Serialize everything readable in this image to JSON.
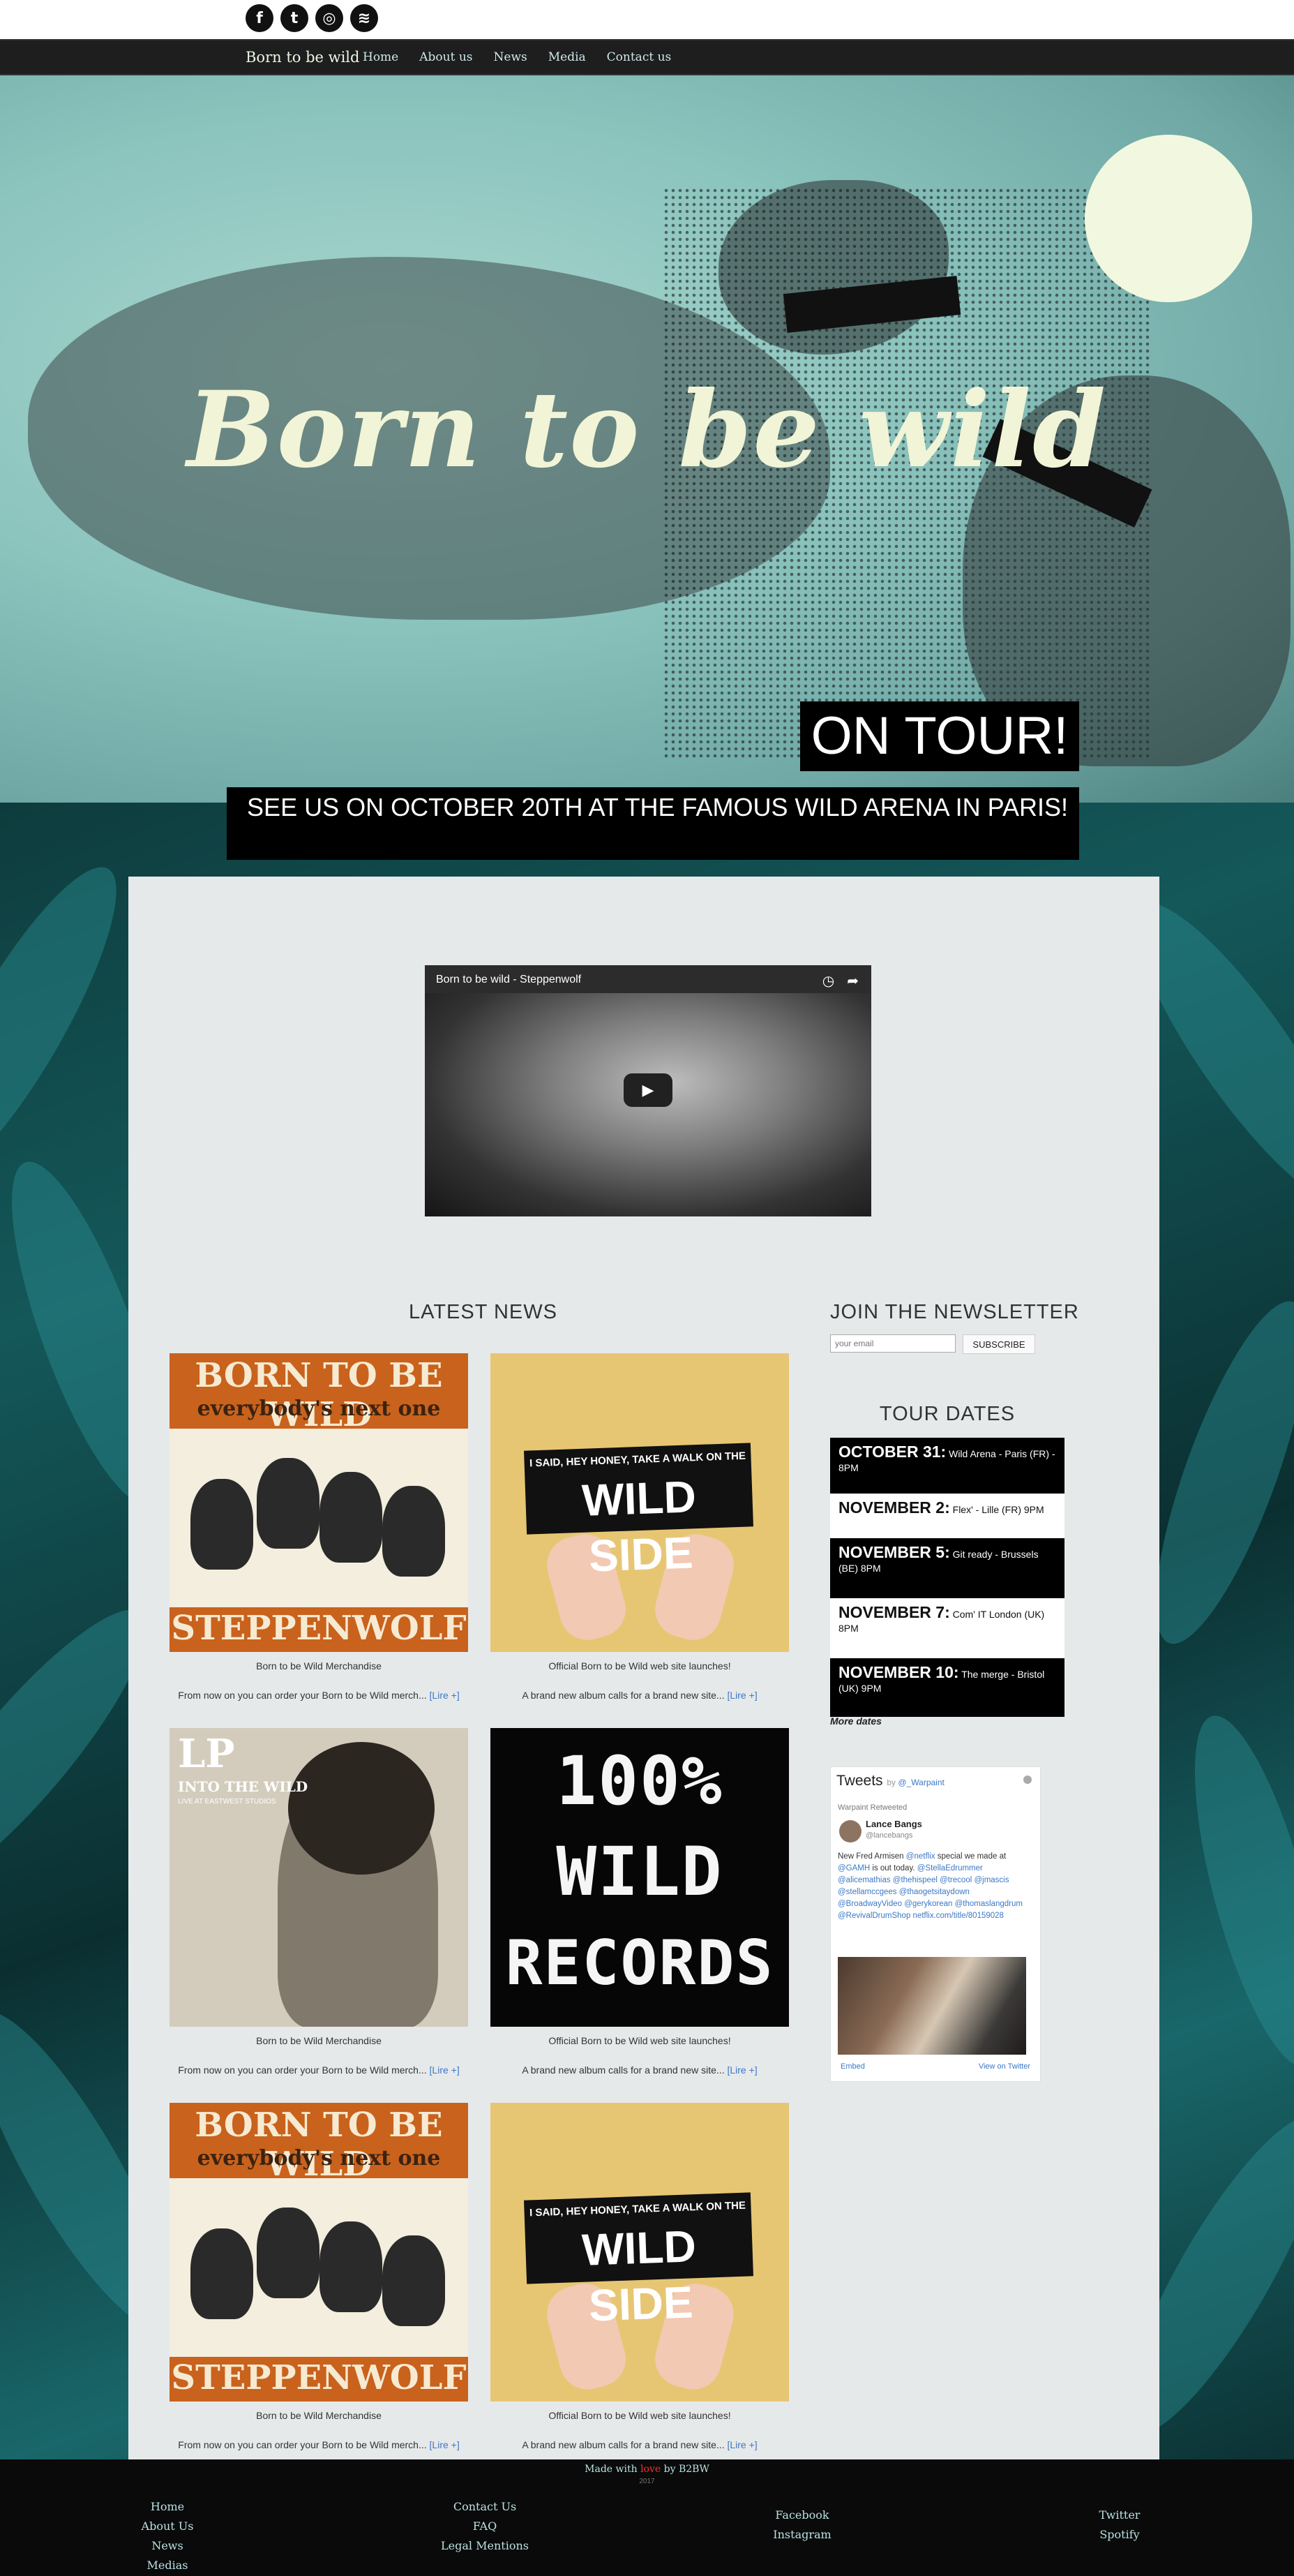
{
  "social": {
    "icons": [
      "facebook-icon",
      "twitter-icon",
      "instagram-icon",
      "spotify-icon"
    ],
    "glyphs": [
      "f",
      "t",
      "◎",
      "≋"
    ]
  },
  "nav": {
    "brand": "Born to be wild",
    "links": [
      "Home",
      "About us",
      "News",
      "Media",
      "Contact us"
    ]
  },
  "hero": {
    "title": "Born to be wild",
    "tour_label": "ON TOUR!",
    "tour_sub": "SEE US ON OCTOBER 20TH AT THE FAMOUS WILD ARENA IN PARIS!"
  },
  "video": {
    "title": "Born to be wild - Steppenwolf",
    "icons": [
      "watch-later-icon",
      "share-icon",
      "play-icon"
    ]
  },
  "news": {
    "heading": "LATEST NEWS",
    "more_label": "[Lire +]",
    "items": [
      {
        "art": "steppenwolf",
        "caption": "Born to be Wild Merchandise",
        "desc": "From now on you can order your Born to be Wild merch..."
      },
      {
        "art": "wildside",
        "caption": "Official Born to be Wild web site launches!",
        "desc": "A brand new album calls for a brand new site..."
      },
      {
        "art": "lp",
        "caption": "Born to be Wild Merchandise",
        "desc": "From now on you can order your Born to be Wild merch..."
      },
      {
        "art": "records",
        "caption": "Official Born to be Wild web site launches!",
        "desc": "A brand new album calls for a brand new site..."
      },
      {
        "art": "steppenwolf",
        "caption": "Born to be Wild Merchandise",
        "desc": "From now on you can order your Born to be Wild merch..."
      },
      {
        "art": "wildside",
        "caption": "Official Born to be Wild web site launches!",
        "desc": "A brand new album calls for a brand new site..."
      }
    ],
    "art_text": {
      "steppenwolf": {
        "line1": "BORN TO BE WILD",
        "line2": "everybody's next one",
        "line3": "STEPPENWOLF"
      },
      "wildside": {
        "line1": "I SAID, HEY HONEY, TAKE A WALK ON THE",
        "line2": "WILD SIDE"
      },
      "lp": {
        "line1": "LP",
        "line2": "INTO THE WILD",
        "line3": "LIVE AT EASTWEST STUDIOS"
      },
      "records": {
        "line1": "100%",
        "line2": "WILD",
        "line3": "RECORDS"
      }
    }
  },
  "newsletter": {
    "heading": "JOIN THE NEWSLETTER",
    "placeholder": "your email",
    "button": "SUBSCRIBE"
  },
  "tour": {
    "heading": "TOUR DATES",
    "dates": [
      {
        "date": "OCTOBER 31:",
        "info": "Wild Arena - Paris (FR) - 8PM",
        "style": "dark"
      },
      {
        "date": "NOVEMBER 2:",
        "info": "Flex' - Lille (FR) 9PM",
        "style": "light"
      },
      {
        "date": "NOVEMBER 5:",
        "info": "Git ready - Brussels (BE) 8PM",
        "style": "dark"
      },
      {
        "date": "NOVEMBER 7:",
        "info": "Com' IT London (UK) 8PM",
        "style": "light"
      },
      {
        "date": "NOVEMBER 10:",
        "info": "The merge - Bristol (UK) 9PM",
        "style": "dark"
      }
    ],
    "more": "More dates"
  },
  "twitter": {
    "title": "Tweets",
    "by": "by",
    "handle": "@_Warpaint",
    "retweet": "Warpaint Retweeted",
    "author": "Lance Bangs",
    "author_handle": "@lancebangs",
    "body_text": "New Fred Armisen",
    "body_text2": "special we made at",
    "body_text3": "is out today.",
    "links": [
      "@netflix",
      "@GAMH",
      "@StellaEdrummer",
      "@alicemathias @thehispeel @trecool @jmascis @stellamccgees @thaogetsitaydown @BroadwayVideo @gerykorean @thomaslangdrum @RevivalDrumShop netflix.com/title/80159028"
    ],
    "embed": "Embed",
    "view": "View on Twitter"
  },
  "footer": {
    "made_prefix": "Made with",
    "love": "love",
    "made_suffix": "by B2BW",
    "year": "2017",
    "col1": [
      "Home",
      "About Us",
      "News",
      "Medias"
    ],
    "col2": [
      "Contact Us",
      "FAQ",
      "Legal Mentions"
    ],
    "col3": [
      "Facebook",
      "Instagram"
    ],
    "col4": [
      "Twitter",
      "Spotify"
    ]
  }
}
